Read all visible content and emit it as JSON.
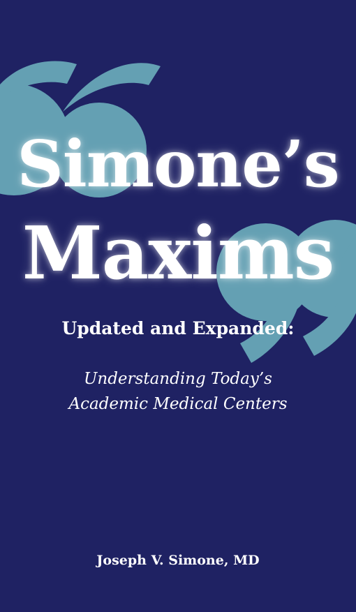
{
  "cover": {
    "title_line_1": "Simone’s",
    "title_line_2": "Maxims",
    "subtitle": "Updated and Expanded:",
    "tagline_line_1": "Understanding Today’s",
    "tagline_line_2": "Academic Medical Centers",
    "author": "Joseph V. Simone, MD",
    "background_color": "#1f2263",
    "quote_mark_color": "#64a0b3",
    "text_color": "#ffffff",
    "decoration_icon": "quotation-mark-icon"
  }
}
